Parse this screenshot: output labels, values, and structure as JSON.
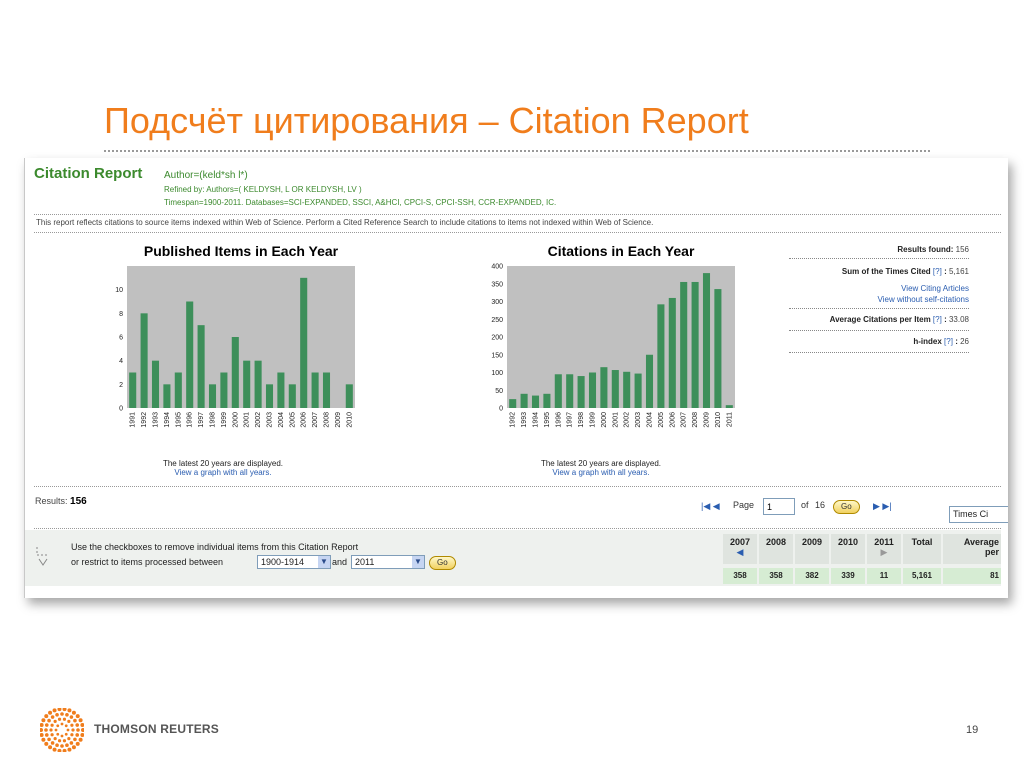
{
  "slide": {
    "title": "Подсчёт цитирования – Citation Report",
    "brand": "THOMSON REUTERS",
    "page_number": "19"
  },
  "report": {
    "title": "Citation Report",
    "query": "Author=(keld*sh l*)",
    "refined_by": "Refined by: Authors=( KELDYSH, L OR KELDYSH, LV )",
    "timespan": "Timespan=1900-2011. Databases=SCI-EXPANDED, SSCI, A&HCI, CPCI-S, CPCI-SSH, CCR-EXPANDED, IC.",
    "notice": "This report reflects citations to source items indexed within Web of Science. Perform a Cited Reference Search to include citations to items not indexed within Web of Science."
  },
  "notes": {
    "latest": "The latest 20 years are displayed.",
    "view_all": "View a graph with all years."
  },
  "stats": {
    "results_found_label": "Results found:",
    "results_found_value": "156",
    "sum_label": "Sum of the Times Cited",
    "sum_value": "5,161",
    "view_citing": "View Citing Articles",
    "view_without_self": "View without self-citations",
    "avg_label": "Average Citations per Item",
    "avg_value": "33.08",
    "hindex_label": "h-index",
    "hindex_value": "26",
    "help": "[?]"
  },
  "results_bar": {
    "label": "Results:",
    "value": "156",
    "page_label": "Page",
    "page_value": "1",
    "of_label": "of",
    "total_pages": "16",
    "go": "Go",
    "sort_value": "Times Ci"
  },
  "bottom": {
    "remove_text": "Use the checkboxes to remove individual items from this Citation Report",
    "restrict_text": "or restrict to items processed between",
    "from_value": "1900-1914",
    "and_label": "and",
    "to_value": "2011",
    "go": "Go",
    "years": [
      "2007",
      "2008",
      "2009",
      "2010",
      "2011"
    ],
    "year_values": [
      "358",
      "358",
      "382",
      "339",
      "11"
    ],
    "total_label": "Total",
    "total_value": "5,161",
    "average_label": "Average",
    "average_label2": "per",
    "average_value": "81"
  },
  "chart_data": [
    {
      "type": "bar",
      "title": "Published Items in Each Year",
      "xlabel": "Years",
      "ylabel": "",
      "categories": [
        "1991",
        "1992",
        "1993",
        "1994",
        "1995",
        "1996",
        "1997",
        "1998",
        "1999",
        "2000",
        "2001",
        "2002",
        "2003",
        "2004",
        "2005",
        "2006",
        "2007",
        "2008",
        "2009",
        "2010"
      ],
      "values": [
        3,
        8,
        4,
        2,
        3,
        9,
        7,
        2,
        3,
        6,
        4,
        4,
        2,
        3,
        2,
        11,
        3,
        3,
        0,
        2
      ],
      "ylim": [
        0,
        12
      ],
      "yticks": [
        0,
        2,
        4,
        6,
        8,
        10
      ],
      "grid": false,
      "color": "#3d8f5a",
      "background": "#c0c0c0"
    },
    {
      "type": "bar",
      "title": "Citations in Each Year",
      "xlabel": "Years",
      "ylabel": "",
      "categories": [
        "1992",
        "1993",
        "1994",
        "1995",
        "1996",
        "1997",
        "1998",
        "1999",
        "2000",
        "2001",
        "2002",
        "2003",
        "2004",
        "2005",
        "2006",
        "2007",
        "2008",
        "2009",
        "2010",
        "2011"
      ],
      "values": [
        25,
        40,
        35,
        40,
        95,
        95,
        90,
        100,
        115,
        107,
        102,
        97,
        150,
        292,
        310,
        355,
        355,
        380,
        335,
        8
      ],
      "ylim": [
        0,
        400
      ],
      "yticks": [
        0,
        50,
        100,
        150,
        200,
        250,
        300,
        350,
        400
      ],
      "grid": false,
      "color": "#3d8f5a",
      "background": "#c0c0c0"
    }
  ]
}
